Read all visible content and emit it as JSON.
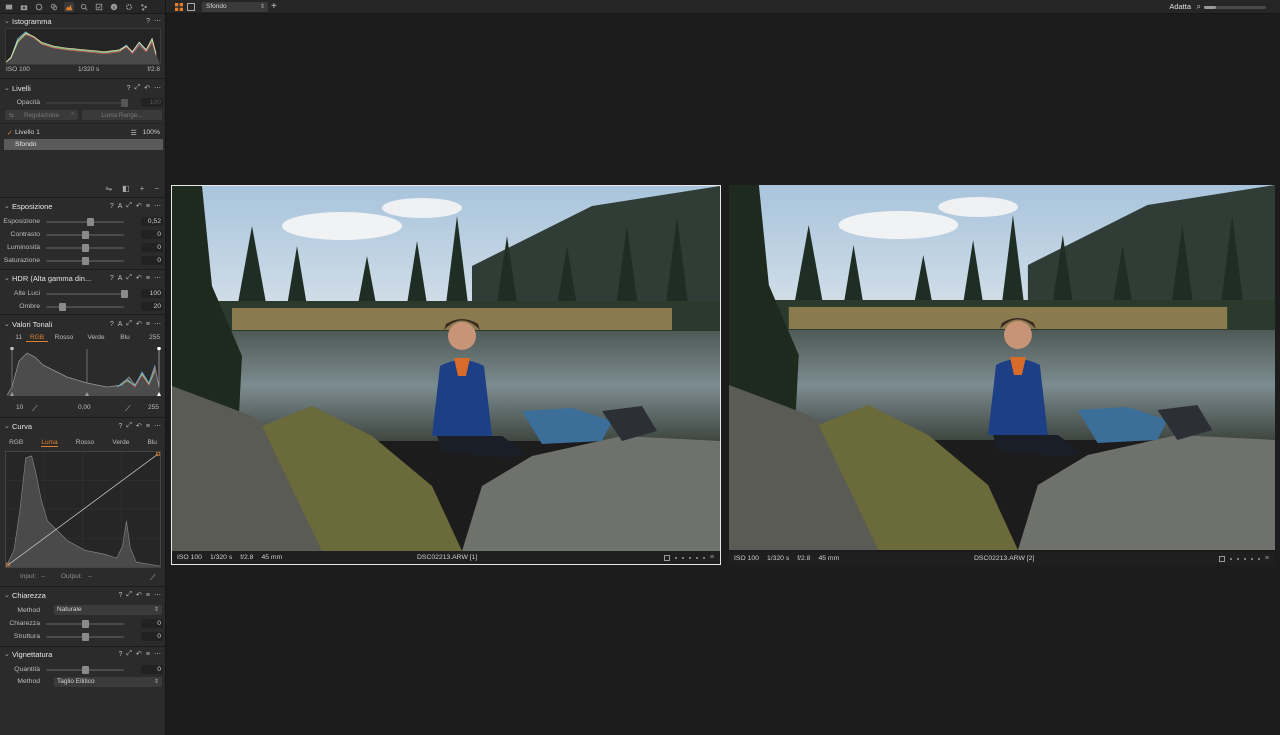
{
  "toolbar": {
    "view_select": "Sfondo",
    "zoom_label": "Adatta",
    "zoom_level": 0.2
  },
  "histogram": {
    "title": "Istogramma",
    "iso": "ISO 100",
    "shutter": "1/320 s",
    "aperture": "f/2.8"
  },
  "layers": {
    "title": "Livelli",
    "opacity_label": "Opacità",
    "opacity_value": "100",
    "btn_regolazione": "Regolazione",
    "btn_luma": "Luma Range...",
    "items": [
      {
        "name": "Livello 1",
        "opacity": "100%"
      },
      {
        "name": "Sfondo"
      }
    ]
  },
  "exposure": {
    "title": "Esposizione",
    "rows": [
      {
        "label": "Esposizione",
        "value": "0,52",
        "pos": 0.56
      },
      {
        "label": "Contrasto",
        "value": "0",
        "pos": 0.5
      },
      {
        "label": "Luminosità",
        "value": "0",
        "pos": 0.5
      },
      {
        "label": "Saturazione",
        "value": "0",
        "pos": 0.5
      }
    ]
  },
  "hdr": {
    "title": "HDR (Alta gamma din...",
    "rows": [
      {
        "label": "Alte Luci",
        "value": "100",
        "pos": 1.0
      },
      {
        "label": "Ombre",
        "value": "20",
        "pos": 0.2
      }
    ]
  },
  "levels": {
    "title": "Valori Tonali",
    "tabs": [
      "RGB",
      "Rosso",
      "Verde",
      "Blu"
    ],
    "active_tab": "RGB",
    "in_low": "11",
    "in_high": "255",
    "out_low": "10",
    "mid": "0,00",
    "out_high": "255"
  },
  "curve": {
    "title": "Curva",
    "tabs": [
      "RGB",
      "Luma",
      "Rosso",
      "Verde",
      "Blu"
    ],
    "active_tab": "Luma",
    "input_label": "Input:",
    "input_value": "--",
    "output_label": "Output:",
    "output_value": "--"
  },
  "clarity": {
    "title": "Chiarezza",
    "method_label": "Method",
    "method_value": "Naturale",
    "rows": [
      {
        "label": "Chiarezza",
        "value": "0",
        "pos": 0.5
      },
      {
        "label": "Struttura",
        "value": "0",
        "pos": 0.5
      }
    ]
  },
  "vignette": {
    "title": "Vignettatura",
    "rows": [
      {
        "label": "Quantità",
        "value": "0",
        "pos": 0.5
      }
    ],
    "method_label": "Method",
    "method_value": "Taglio Ellitico"
  },
  "images": [
    {
      "iso": "ISO 100",
      "shutter": "1/320 s",
      "aperture": "f/2.8",
      "focal": "45 mm",
      "filename": "DSC02213.ARW [1]"
    },
    {
      "iso": "ISO 100",
      "shutter": "1/320 s",
      "aperture": "f/2.8",
      "focal": "45 mm",
      "filename": "DSC02213.ARW [2]"
    }
  ],
  "colors": {
    "accent": "#e3802e",
    "panel_bg": "#2b2b2b",
    "viewer_bg": "#1c1c1c"
  }
}
